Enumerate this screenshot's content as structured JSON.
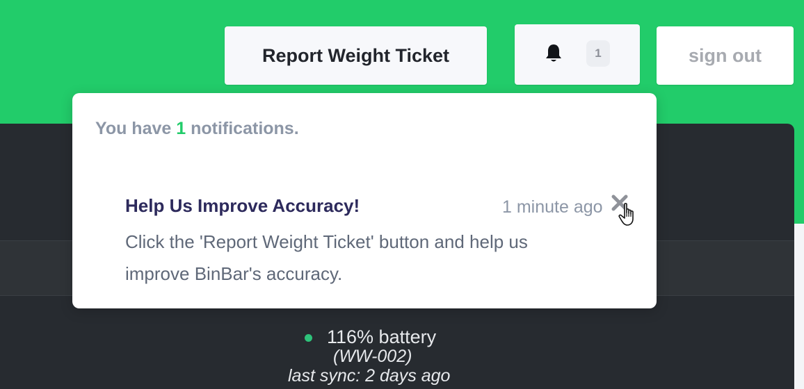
{
  "header": {
    "report_button_label": "Report Weight Ticket",
    "notification_badge_count": "1",
    "sign_out_label": "sign out"
  },
  "notifications": {
    "summary_prefix": "You have ",
    "summary_count": "1",
    "summary_suffix": " notifications.",
    "items": [
      {
        "title": "Help Us Improve Accuracy!",
        "time": "1 minute ago",
        "body": "Click the 'Report Weight Ticket' button and help us improve BinBar's accuracy."
      }
    ]
  },
  "device": {
    "battery": "116% battery",
    "id": "(WW-002)",
    "last_sync": "last sync: 2 days ago",
    "status_color": "#2ec27a"
  },
  "colors": {
    "brand_green": "#22cc6a",
    "dark_panel": "#272b30"
  },
  "icons": {
    "bell": "bell-icon",
    "close": "close-icon",
    "cursor": "hand-pointer-cursor"
  }
}
